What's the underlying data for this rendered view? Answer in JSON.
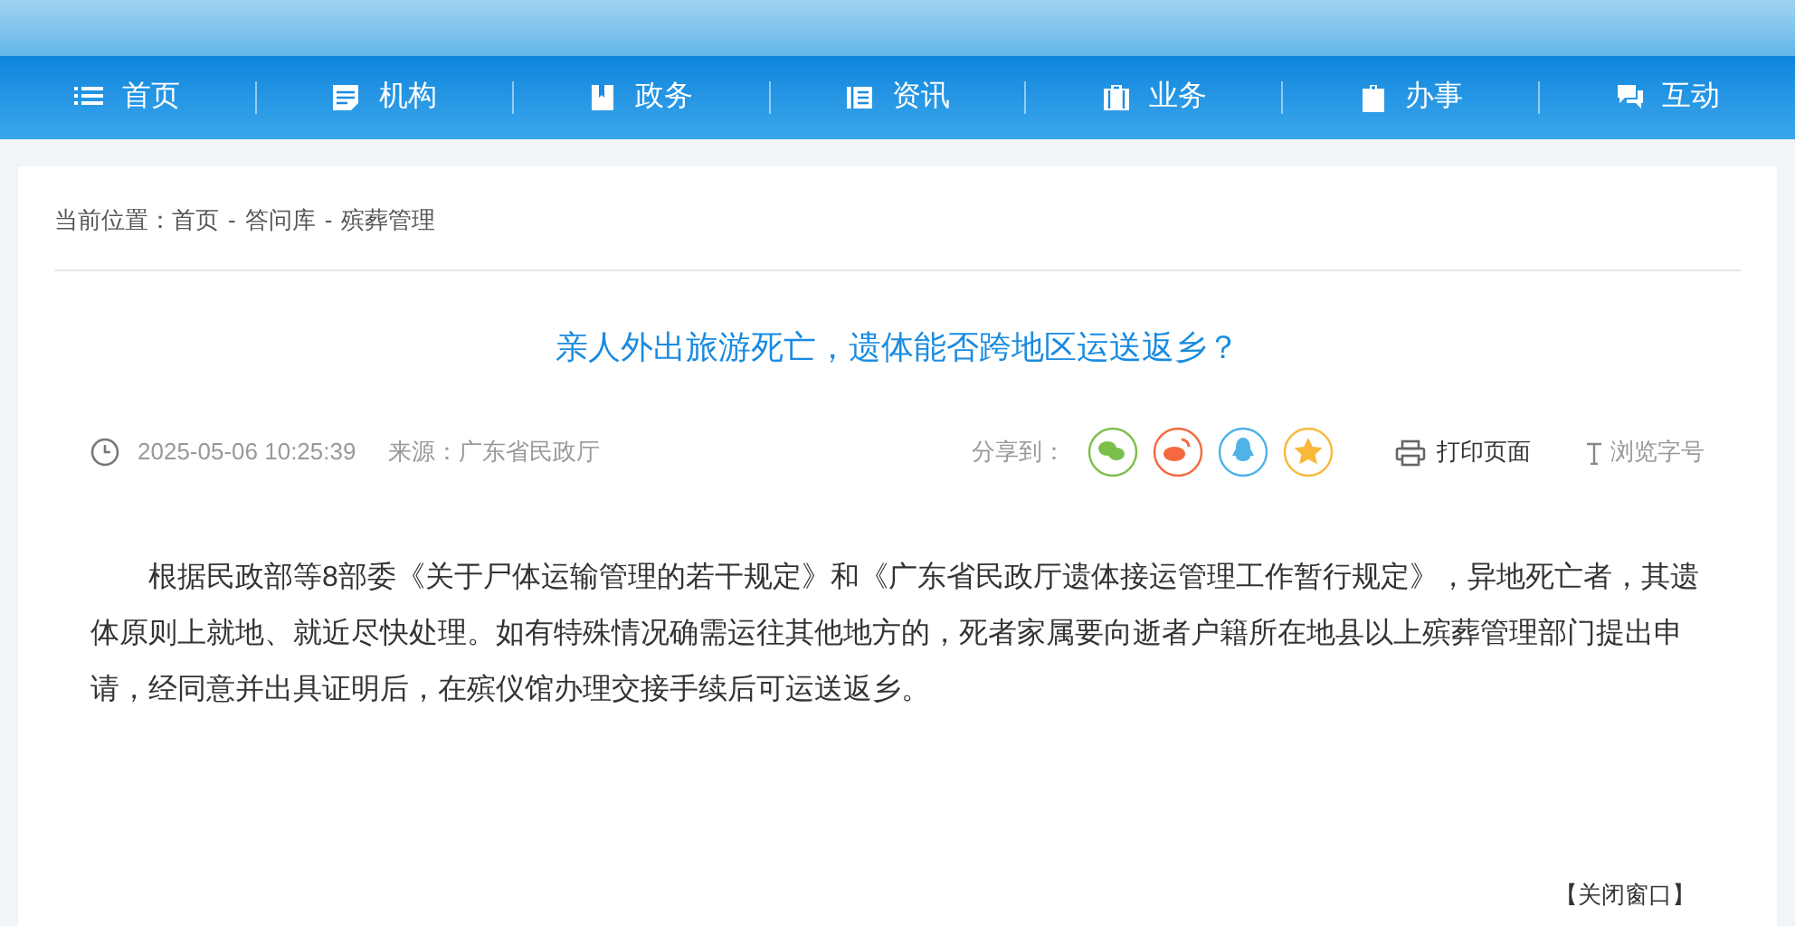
{
  "nav": [
    {
      "label": "首页",
      "kind": "list"
    },
    {
      "label": "机构",
      "kind": "doc"
    },
    {
      "label": "政务",
      "kind": "book"
    },
    {
      "label": "资讯",
      "kind": "news"
    },
    {
      "label": "业务",
      "kind": "case"
    },
    {
      "label": "办事",
      "kind": "clip"
    },
    {
      "label": "互动",
      "kind": "chat"
    }
  ],
  "breadcrumb": {
    "prefix": "当前位置：",
    "items": [
      "首页",
      "答问库",
      "殡葬管理"
    ],
    "separator": "-"
  },
  "article": {
    "title": "亲人外出旅游死亡，遗体能否跨地区运送返乡？",
    "date": "2025-05-06 10:25:39",
    "source": "来源：广东省民政厅",
    "share_label": "分享到：",
    "share": [
      {
        "kind": "wechat",
        "color": "#7cc04b"
      },
      {
        "kind": "weibo",
        "color": "#f4693f"
      },
      {
        "kind": "qq",
        "color": "#4fb3e8"
      },
      {
        "kind": "qzone",
        "color": "#f8b93a"
      }
    ],
    "print": "打印页面",
    "font_size": "浏览字号",
    "body": "根据民政部等8部委《关于尸体运输管理的若干规定》和《广东省民政厅遗体接运管理工作暂行规定》，异地死亡者，其遗体原则上就地、就近尽快处理。如有特殊情况确需运往其他地方的，死者家属要向逝者户籍所在地县以上殡葬管理部门提出申请，经同意并出具证明后，在殡仪馆办理交接手续后可运送返乡。",
    "close": "【关闭窗口】"
  }
}
